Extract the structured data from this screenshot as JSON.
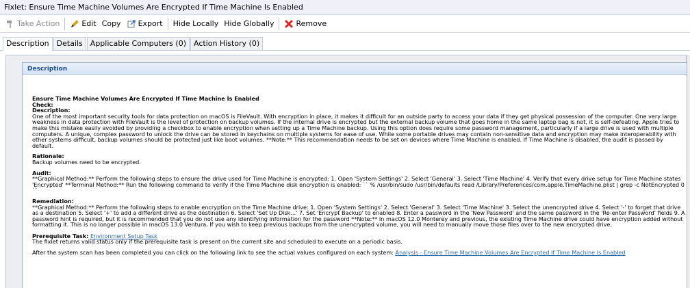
{
  "window": {
    "title": "Fixlet: Ensure Time Machine Volumes Are Encrypted If Time Machine Is Enabled"
  },
  "toolbar": {
    "take_action": "Take Action",
    "edit": "Edit",
    "copy": "Copy",
    "export": "Export",
    "hide_locally": "Hide Locally",
    "hide_globally": "Hide Globally",
    "remove": "Remove",
    "colors": {
      "edit_icon": "#f2b400",
      "remove_icon": "#e0201b"
    }
  },
  "tabs": [
    {
      "label": "Description"
    },
    {
      "label": "Details"
    },
    {
      "label": "Applicable Computers (0)"
    },
    {
      "label": "Action History (0)"
    }
  ],
  "panel": {
    "header": "Description",
    "title": "Ensure Time Machine Volumes Are Encrypted If Time Machine Is Enabled",
    "check_label": "Check:",
    "description_label": "Description:",
    "description_text": "One of the most important security tools for data protection on macOS is FileVault. With encryption in place, it makes it difficult for an outside party to access your data if they get physical possession of the computer. One very large weakness in data protection with FileVault is the level of protection on backup volumes. If the internal drive is encrypted but the external backup volume that goes home in the same laptop bag is not, it is self-defeating. Apple tries to make this mistake easily avoided by providing a checkbox to enable encryption when setting up a Time Machine backup. Using this option does require some password management, particularly if a large drive is used with multiple computers. A unique, complex password to unlock the drive can be stored in keychains on multiple systems for ease of use. While some portable drives may contain non-sensitive data and encryption may make interoperability with other systems difficult, backup volumes should be protected just like boot volumes. **Note:** This recommendation needs to be set on devices where Time Machine is enabled. If Time Machine is disabled, the audit is passed by default.",
    "rationale_label": "Rationale:",
    "rationale_text": "Backup volumes need to be encrypted.",
    "audit_label": "Audit:",
    "audit_text": "**Graphical Method:** Perform the following steps to ensure the drive used for Time Machine is encrypted: 1. Open 'System Settings' 2. Select 'General' 3. Select 'Time Machine' 4. Verify that every drive setup for Time Machine states 'Encrypted' **Terminal Method:** Run the following command to verify if the Time Machine disk encryption is enabled: `` % /usr/bin/sudo /usr/bin/defaults read /Library/Preferences/com.apple.TimeMachine.plist | grep -c NotEncrypted 0 ``",
    "remediation_label": "Remediation:",
    "remediation_text": "**Graphical Method:** Perform the following steps to enable encryption on the Time Machine drive: 1. Open 'System Settings' 2. Select 'General' 3. Select 'Time Machine' 3. Select the unencrypted drive 4. Select '-' to forget that drive as a destination 5. Select '+' to add a different drive as the destination 6. Select 'Set Up Disk...' 7. Set 'Encrypt Backup' to enabled 8. Enter a password in the 'New Password' and the same password in the 'Re-enter Password' fields 9. A password hint is required, but it is recommended that you do not use any identifying information for the password **Note:** In macOS 12.0 Monterey and previous, the existing Time Machine drive could have encryption added without formatting it. This is no longer possible in macOS 13.0 Ventura. If you wish to keep previous backups from the unencrypted volume, you will need to manually move those files over to the new encrypted drive.",
    "prereq_label": "Prerequisite Task:",
    "prereq_link": "Environment Setup Task",
    "prereq_text": "The fixlet returns valid status only if the prerequisite task is present on the current site and scheduled to execute on a periodic basis.",
    "after_scan_text": "After the system scan has been completed you can click on the following link to see the actual values configured on each system:",
    "analysis_link": "Analysis - Ensure Time Machine Volumes Are Encrypted If Time Machine Is Enabled"
  }
}
